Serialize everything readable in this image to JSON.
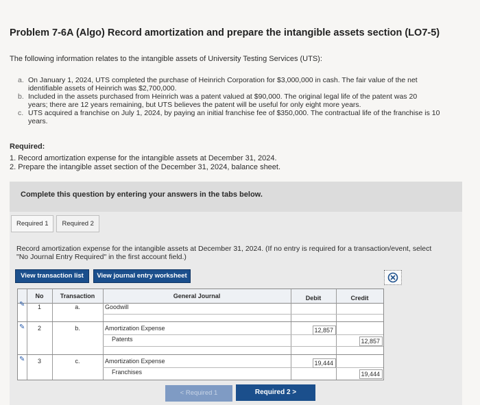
{
  "problem": {
    "title": "Problem 7-6A (Algo) Record amortization and prepare the intangible assets section (LO7-5)",
    "intro": "The following information relates to the intangible assets of University Testing Services (UTS):",
    "items": [
      {
        "letter": "a.",
        "line1": "On January 1, 2024, UTS completed the purchase of Heinrich Corporation for $3,000,000 in cash. The fair value of the net",
        "line2": "identifiable assets of Heinrich was $2,700,000."
      },
      {
        "letter": "b.",
        "line1": "Included in the assets purchased from Heinrich was a patent valued at $90,000. The original legal life of the patent was 20",
        "line2": "years; there are 12 years remaining, but UTS believes the patent will be useful for only eight more years."
      },
      {
        "letter": "c.",
        "line1": "UTS acquired a franchise on July 1, 2024, by paying an initial franchise fee of $350,000. The contractual life of the franchise is 10",
        "line2": "years."
      }
    ],
    "required_heading": "Required:",
    "required": [
      "1. Record amortization expense for the intangible assets at December 31, 2024.",
      "2. Prepare the intangible asset section of the December 31, 2024, balance sheet."
    ]
  },
  "banner": "Complete this question by entering your answers in the tabs below.",
  "tabs": [
    "Required 1",
    "Required 2"
  ],
  "instruction_line1": "Record amortization expense for the intangible assets at December 31, 2024. (If no entry is required for a transaction/event, select",
  "instruction_line2": "\"No Journal Entry Required\" in the first account field.)",
  "buttons": {
    "view_list": "View transaction list",
    "view_worksheet": "View journal entry worksheet"
  },
  "grid": {
    "headers": {
      "no": "No",
      "transaction": "Transaction",
      "journal": "General Journal",
      "debit": "Debit",
      "credit": "Credit"
    },
    "rows": [
      {
        "no": "1",
        "transaction": "a.",
        "account": "Goodwill",
        "credit_account": "",
        "debit": "",
        "credit": ""
      },
      {
        "no": "2",
        "transaction": "b.",
        "account": "Amortization Expense",
        "credit_account": "Patents",
        "debit": "12,857",
        "credit": "12,857"
      },
      {
        "no": "3",
        "transaction": "c.",
        "account": "Amortization Expense",
        "credit_account": "Franchises",
        "debit": "19,444",
        "credit": "19,444"
      }
    ]
  },
  "nav": {
    "prev": "< Required 1",
    "next": "Required 2  >"
  }
}
